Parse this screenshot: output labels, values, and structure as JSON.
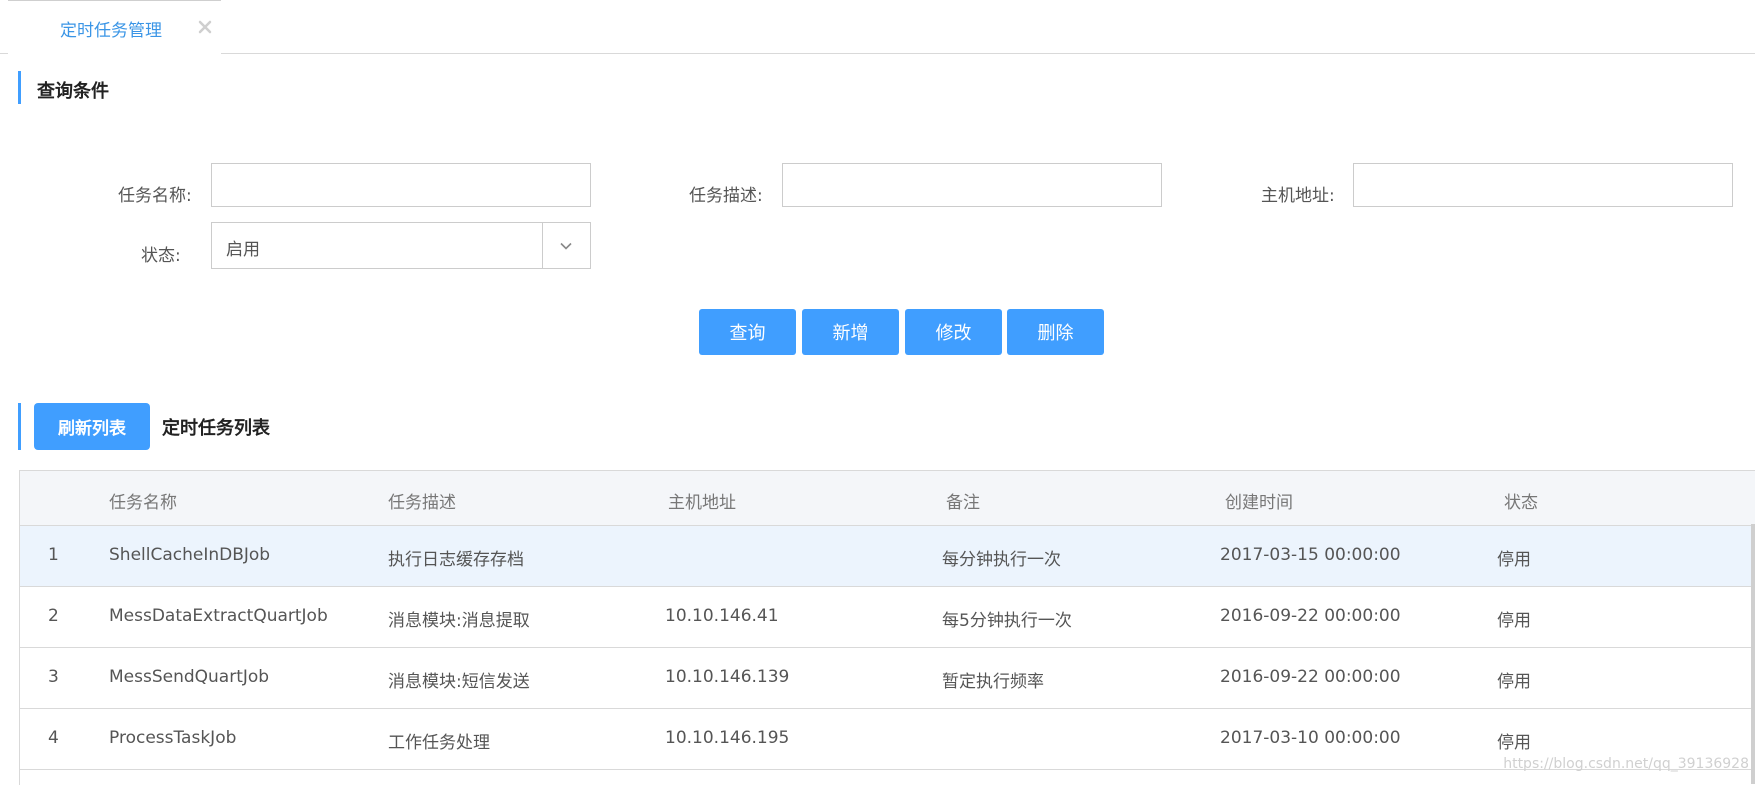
{
  "tab": {
    "label": "定时任务管理"
  },
  "query": {
    "title": "查询条件",
    "fields": {
      "task_name_label": "任务名称:",
      "task_name_value": "",
      "task_desc_label": "任务描述:",
      "task_desc_value": "",
      "host_label": "主机地址:",
      "host_value": "",
      "status_label": "状态:",
      "status_value": "启用"
    },
    "buttons": {
      "search": "查询",
      "add": "新增",
      "edit": "修改",
      "delete": "删除"
    }
  },
  "list": {
    "refresh_label": "刷新列表",
    "title": "定时任务列表",
    "columns": [
      "任务名称",
      "任务描述",
      "主机地址",
      "备注",
      "创建时间",
      "状态"
    ],
    "rows": [
      {
        "idx": "1",
        "name": "ShellCacheInDBJob",
        "desc": "执行日志缓存存档",
        "host": "",
        "remark": "每分钟执行一次",
        "created": "2017-03-15 00:00:00",
        "status": "停用"
      },
      {
        "idx": "2",
        "name": "MessDataExtractQuartJob",
        "desc": "消息模块:消息提取",
        "host": "10.10.146.41",
        "remark": "每5分钟执行一次",
        "created": "2016-09-22 00:00:00",
        "status": "停用"
      },
      {
        "idx": "3",
        "name": "MessSendQuartJob",
        "desc": "消息模块:短信发送",
        "host": "10.10.146.139",
        "remark": "暂定执行频率",
        "created": "2016-09-22 00:00:00",
        "status": "停用"
      },
      {
        "idx": "4",
        "name": "ProcessTaskJob",
        "desc": "工作任务处理",
        "host": "10.10.146.195",
        "remark": "",
        "created": "2017-03-10 00:00:00",
        "status": "停用"
      }
    ]
  },
  "watermark": "https://blog.csdn.net/qq_39136928",
  "colors": {
    "accent": "#409eff",
    "selected_row": "#ecf4fd",
    "header_bg": "#f4f6f9"
  }
}
